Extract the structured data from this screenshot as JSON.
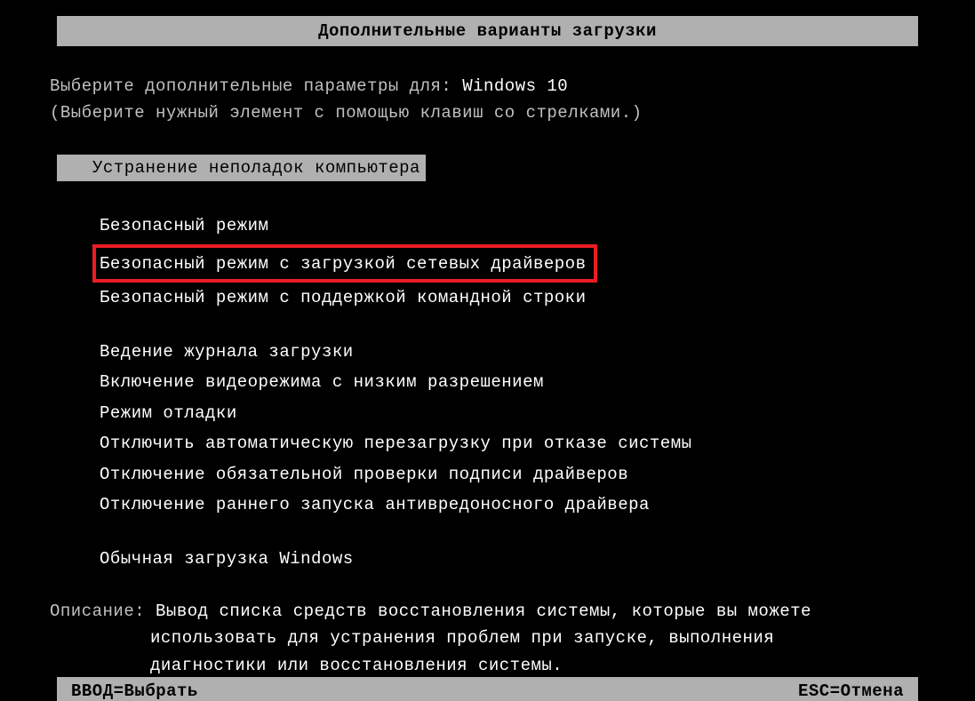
{
  "title": "Дополнительные варианты загрузки",
  "prompt": {
    "prefix": "Выберите дополнительные параметры для: ",
    "os": "Windows 10"
  },
  "hint": "(Выберите нужный элемент с помощью клавиш со стрелками.)",
  "selected_item": "Устранение неполадок компьютера",
  "menu_group1": {
    "item0": "Безопасный режим",
    "item1": "Безопасный режим с загрузкой сетевых драйверов",
    "item2": "Безопасный режим с поддержкой командной строки"
  },
  "menu_group2": {
    "item0": "Ведение журнала загрузки",
    "item1": "Включение видеорежима с низким разрешением",
    "item2": "Режим отладки",
    "item3": "Отключить автоматическую перезагрузку при отказе системы",
    "item4": "Отключение обязательной проверки подписи драйверов",
    "item5": "Отключение раннего запуска антивредоносного драйвера"
  },
  "menu_group3": {
    "item0": "Обычная загрузка Windows"
  },
  "description": {
    "label": "Описание: ",
    "line1": "Вывод списка средств восстановления системы, которые вы можете",
    "line2": "использовать для устранения проблем при запуске, выполнения",
    "line3": "диагностики или восстановления системы."
  },
  "footer": {
    "enter": "ВВОД=Выбрать",
    "esc": "ESC=Отмена"
  }
}
